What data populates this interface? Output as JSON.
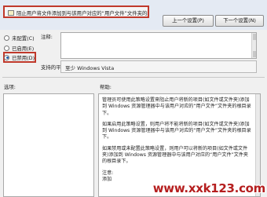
{
  "header": {
    "policy_title": "阻止用户将文件添加到与该用户对应的“用户文件”文件夹的根目录下。",
    "prev_button": "上一个设置(P)",
    "next_button": "下一个设置(N)"
  },
  "state": {
    "options": [
      {
        "label": "未配置(C)",
        "checked": false
      },
      {
        "label": "已启用(E)",
        "checked": false
      },
      {
        "label": "已禁用(D)",
        "checked": true
      }
    ]
  },
  "comment": {
    "label": "注释:",
    "value": ""
  },
  "supported": {
    "label": "支持的平台:",
    "value": "至少 Windows Vista"
  },
  "options_section": {
    "label": "选项:"
  },
  "help_section": {
    "label": "帮助:",
    "paragraphs": [
      "管理员可使用此策略设置来阻止用户将新的项目(如文件或文件夹)添加到 Windows 资源管理器中与该用户对应的“用户文件”文件夹的根目录下。",
      "如果启用此策略设置，则用户将不能将新的项目(如文件或文件夹)添加到 Windows 资源管理器中与该用户对应的“用户文件”文件夹的根目录下。",
      "如果禁用或未配置此策略设置，则用户可以将新的项目(如文件或文件夹)添加到 Windows 资源管理器中与该用户对应的“用户文件”文件夹的根目录下。",
      "注意:",
      "添加"
    ]
  },
  "watermark": "www.xxk123.com",
  "colors": {
    "highlight_border": "#c0392b",
    "watermark": "#b51e1e"
  }
}
